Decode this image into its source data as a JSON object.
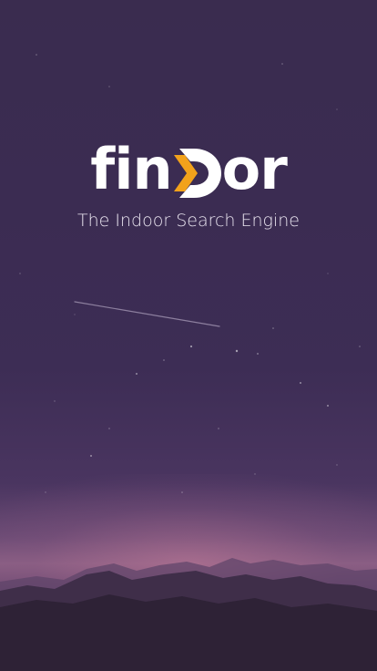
{
  "app": {
    "logo_left": "fin",
    "logo_right": "or",
    "logo_mark_icon": "chevron-door-icon",
    "tagline": "The Indoor Search Engine"
  },
  "colors": {
    "logo_text": "#ffffff",
    "logo_accent": "#f2a21b",
    "tagline": "#e9e4ef",
    "sky_top": "#3a2c4f",
    "horizon": "#8a5f84"
  }
}
